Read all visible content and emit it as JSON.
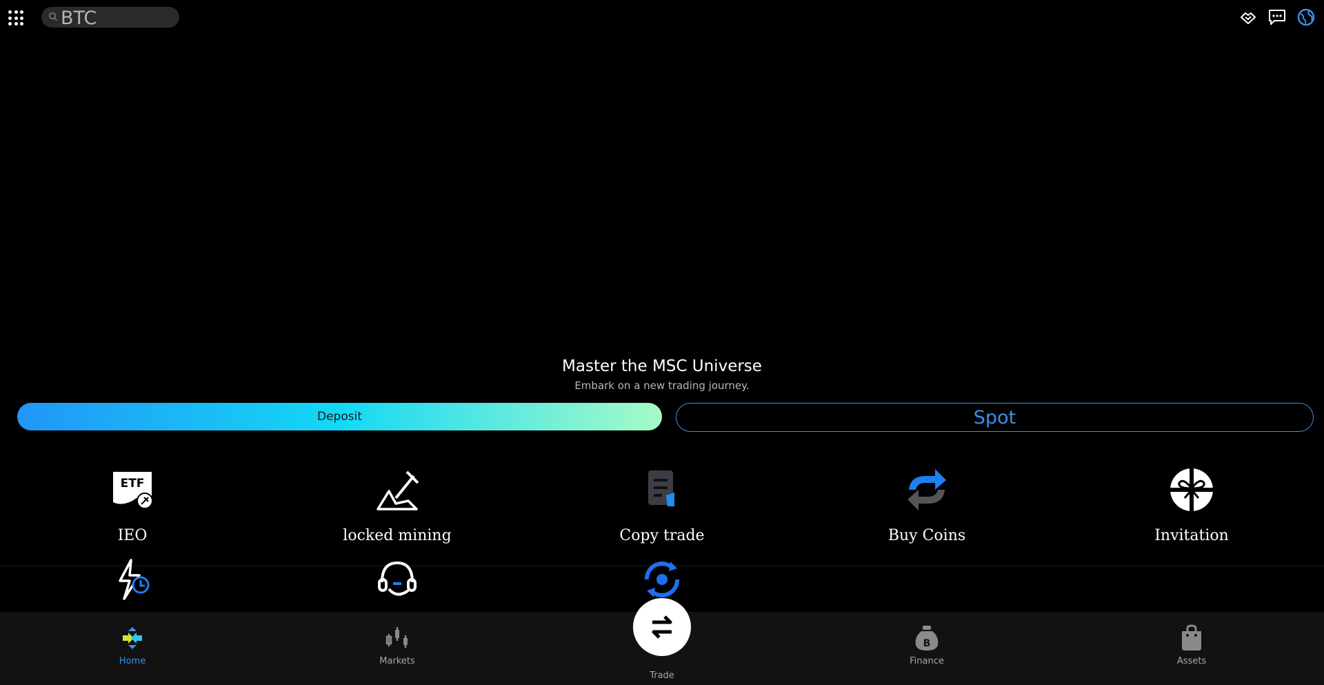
{
  "search": {
    "value": "BTC"
  },
  "hero": {
    "title": "Master the MSC Universe",
    "subtitle": "Embark on a new trading journey."
  },
  "actions": {
    "deposit_label": "Deposit",
    "spot_label": "Spot"
  },
  "tiles": [
    {
      "label": "IEO",
      "icon": "etf-icon"
    },
    {
      "label": "locked mining",
      "icon": "mining-icon"
    },
    {
      "label": "Copy trade",
      "icon": "copy-trade-icon"
    },
    {
      "label": "Buy Coins",
      "icon": "buy-coins-icon"
    },
    {
      "label": "Invitation",
      "icon": "gift-icon"
    }
  ],
  "tiles_row2": [
    {
      "icon": "flash-clock-icon"
    },
    {
      "icon": "headset-icon"
    },
    {
      "icon": "refresh-target-icon"
    }
  ],
  "bottom_nav": {
    "items": [
      {
        "label": "Home",
        "icon": "home-icon",
        "active": true
      },
      {
        "label": "Markets",
        "icon": "markets-icon"
      },
      {
        "label": "Trade",
        "icon": "trade-icon"
      },
      {
        "label": "Finance",
        "icon": "finance-icon"
      },
      {
        "label": "Assets",
        "icon": "assets-icon"
      }
    ]
  },
  "colors": {
    "accent": "#3a92e8",
    "background": "#000000",
    "nav_bg": "#121212"
  }
}
